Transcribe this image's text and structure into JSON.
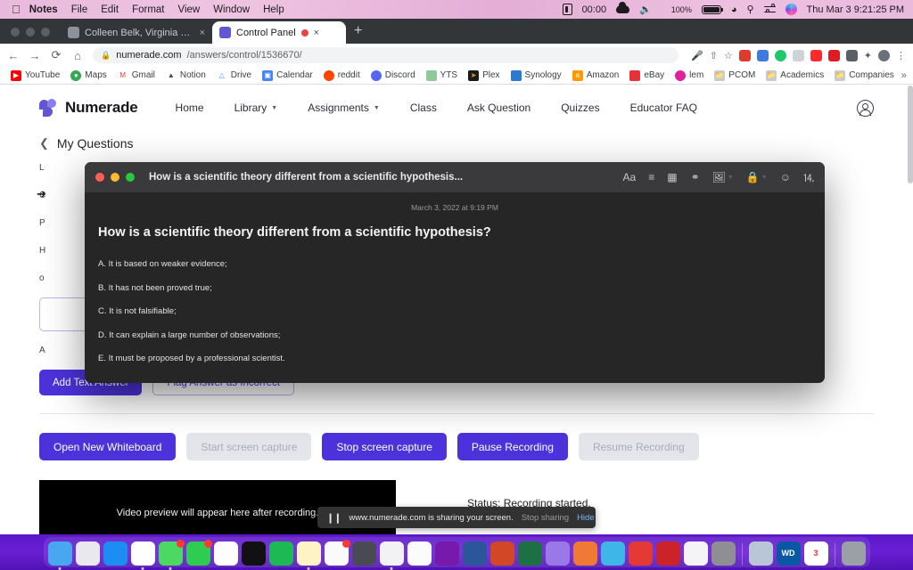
{
  "menubar": {
    "app_name": "Notes",
    "items": [
      "Notes",
      "File",
      "Edit",
      "Format",
      "View",
      "Window",
      "Help"
    ],
    "timer": "00:00",
    "battery": "100%",
    "datetime": "Thu Mar 3  9:21:25 PM"
  },
  "browser": {
    "tabs": [
      {
        "title": "Colleen Belk, Virginia Borden M",
        "active": false
      },
      {
        "title": "Control Panel",
        "active": true
      }
    ],
    "new_tab_label": "+",
    "url_host": "numerade.com",
    "url_path": "/answers/control/1536670/",
    "bookmarks": [
      {
        "label": "YouTube",
        "color": "#ff0000"
      },
      {
        "label": "Maps",
        "color": "#34a853"
      },
      {
        "label": "Gmail",
        "color": "#ea4335"
      },
      {
        "label": "Notion",
        "color": "#ffffff"
      },
      {
        "label": "Drive",
        "color": "#fbbc04"
      },
      {
        "label": "Calendar",
        "color": "#4285f4"
      },
      {
        "label": "reddit",
        "color": "#ff4500"
      },
      {
        "label": "Discord",
        "color": "#5865f2"
      },
      {
        "label": "YTS",
        "color": "#7ec699"
      },
      {
        "label": "Plex",
        "color": "#1a1a1a"
      },
      {
        "label": "Synology",
        "color": "#2a7ad1"
      },
      {
        "label": "Amazon",
        "color": "#ff9900"
      },
      {
        "label": "eBay",
        "color": "#e53238"
      },
      {
        "label": "lem",
        "color": "#e0219a"
      },
      {
        "label": "PCOM",
        "color": "#b8bcc4"
      },
      {
        "label": "Academics",
        "color": "#b8bcc4"
      },
      {
        "label": "Companies",
        "color": "#b8bcc4"
      }
    ],
    "bookmarks_overflow": "»"
  },
  "site": {
    "brand": "Numerade",
    "nav": [
      {
        "label": "Home",
        "dropdown": false
      },
      {
        "label": "Library",
        "dropdown": true
      },
      {
        "label": "Assignments",
        "dropdown": true
      },
      {
        "label": "Class",
        "dropdown": false
      },
      {
        "label": "Ask Question",
        "dropdown": false
      },
      {
        "label": "Quizzes",
        "dropdown": false
      },
      {
        "label": "Educator FAQ",
        "dropdown": false
      }
    ],
    "breadcrumb": "My Questions",
    "background_lines": [
      "L",
      "C",
      "P",
      "H",
      "o",
      "A"
    ],
    "answer_actions": [
      {
        "label": "Add Text Answer",
        "style": "primary"
      },
      {
        "label": "Flag Answer as Incorrect",
        "style": "outline"
      }
    ],
    "control_buttons": [
      {
        "label": "Open New Whiteboard",
        "style": "primary"
      },
      {
        "label": "Start screen capture",
        "style": "disabled"
      },
      {
        "label": "Stop screen capture",
        "style": "primary"
      },
      {
        "label": "Pause Recording",
        "style": "primary"
      },
      {
        "label": "Resume Recording",
        "style": "disabled"
      }
    ],
    "video_placeholder": "Video preview will appear here after recording.",
    "status_text": "Status: Recording started."
  },
  "notes_window": {
    "title": "How is a scientific theory different from a scientific hypothesis...",
    "date": "March 3, 2022 at 9:19 PM",
    "heading": "How is a scientific theory different from a scientific hypothesis?",
    "options": [
      "A. It is based on weaker evidence;",
      "B. It has not been proved true;",
      "C. It is not falsifiable;",
      "D. It can explain a large number of observations;",
      "E. It must be proposed by a professional scientist."
    ],
    "toolbar_icons": [
      "format-aa-icon",
      "checklist-icon",
      "table-icon",
      "link-icon",
      "media-icon",
      "lock-icon",
      "collaborate-icon",
      "share-icon"
    ]
  },
  "share_bar": {
    "message": "www.numerade.com is sharing your screen.",
    "stop_label": "Stop sharing",
    "hide_label": "Hide"
  },
  "dock": {
    "apps": [
      {
        "name": "finder",
        "color": "#49a7f0",
        "badge": false,
        "dot": true
      },
      {
        "name": "launchpad",
        "color": "#e8e8ee",
        "badge": false,
        "dot": false
      },
      {
        "name": "app-store",
        "color": "#1c8ef3",
        "badge": false,
        "dot": false
      },
      {
        "name": "chrome",
        "color": "#ffffff",
        "badge": false,
        "dot": true
      },
      {
        "name": "messages",
        "color": "#4bd964",
        "badge": true,
        "dot": true
      },
      {
        "name": "facetime",
        "color": "#2ecc50",
        "badge": true,
        "dot": false
      },
      {
        "name": "photos",
        "color": "#fdfdfd",
        "badge": false,
        "dot": false
      },
      {
        "name": "iterm",
        "color": "#111111",
        "badge": false,
        "dot": false
      },
      {
        "name": "spotify",
        "color": "#1db954",
        "badge": false,
        "dot": false
      },
      {
        "name": "notes",
        "color": "#fdf3c4",
        "badge": false,
        "dot": true
      },
      {
        "name": "reminders",
        "color": "#fafafa",
        "badge": true,
        "dot": false
      },
      {
        "name": "freeform",
        "color": "#4a4a55",
        "badge": false,
        "dot": false
      },
      {
        "name": "goodnotes",
        "color": "#f2f2f4",
        "badge": false,
        "dot": true
      },
      {
        "name": "notion",
        "color": "#fbfbfb",
        "badge": false,
        "dot": false
      },
      {
        "name": "onenote",
        "color": "#7719aa",
        "badge": false,
        "dot": false
      },
      {
        "name": "word",
        "color": "#2b579a",
        "badge": false,
        "dot": false
      },
      {
        "name": "powerpoint",
        "color": "#d24726",
        "badge": false,
        "dot": false
      },
      {
        "name": "excel",
        "color": "#1d7044",
        "badge": false,
        "dot": false
      },
      {
        "name": "affinity-photo",
        "color": "#9b78e8",
        "badge": false,
        "dot": false
      },
      {
        "name": "affinity-designer",
        "color": "#f07a35",
        "badge": false,
        "dot": false
      },
      {
        "name": "affinity-publisher",
        "color": "#3fb6e8",
        "badge": false,
        "dot": false
      },
      {
        "name": "1password",
        "color": "#e53935",
        "badge": false,
        "dot": false
      },
      {
        "name": "parallels",
        "color": "#cc2229",
        "badge": false,
        "dot": false
      },
      {
        "name": "screenshot",
        "color": "#f4f4f6",
        "badge": false,
        "dot": false
      },
      {
        "name": "handbrake",
        "color": "#8e8e93",
        "badge": false,
        "dot": false
      }
    ],
    "folders": [
      {
        "name": "downloads-stack",
        "color": "#b8c6d8"
      },
      {
        "name": "wd-drive",
        "color": "#0a57a4",
        "label": "WD"
      },
      {
        "name": "calendar-day",
        "color": "#ffffff",
        "label": "3"
      }
    ],
    "trash": {
      "name": "trash",
      "color": "#9aa0a6"
    }
  }
}
